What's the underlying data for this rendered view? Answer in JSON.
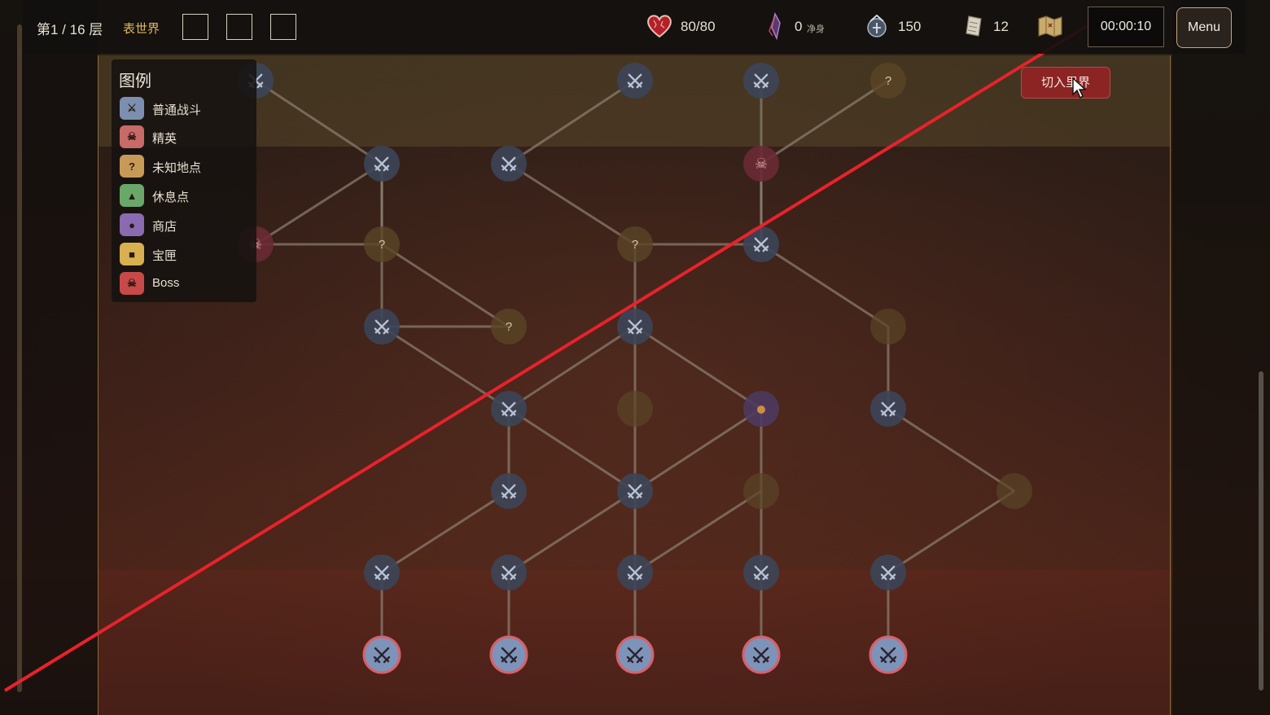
{
  "hud": {
    "floor": "第1 / 16 层",
    "world": "表世界",
    "hp": "80/80",
    "purify_value": "0",
    "purify_label": "净身",
    "soul": "150",
    "cards": "12",
    "timer": "00:00:10",
    "menu_label": "Menu",
    "icons": [
      "heart-icon",
      "crystal-icon",
      "soul-orb-icon",
      "scroll-icon",
      "map-icon"
    ]
  },
  "legend": {
    "title": "图例",
    "items": [
      {
        "label": "普通战斗",
        "icon": "crossed-swords-icon",
        "color": "#7d8fb0"
      },
      {
        "label": "精英",
        "icon": "elite-skull-icon",
        "color": "#c86a68"
      },
      {
        "label": "未知地点",
        "icon": "question-icon",
        "color": "#c89a58"
      },
      {
        "label": "休息点",
        "icon": "campfire-icon",
        "color": "#6aa86a"
      },
      {
        "label": "商店",
        "icon": "shop-bag-icon",
        "color": "#8a6ab0"
      },
      {
        "label": "宝匣",
        "icon": "treasure-chest-icon",
        "color": "#d8b050"
      },
      {
        "label": "Boss",
        "icon": "boss-skull-icon",
        "color": "#c84a48"
      }
    ]
  },
  "switch_button": "切入里界",
  "map": {
    "colors": {
      "combat": "#3c4558",
      "elite": "#6a2a34",
      "unknown": "#5a4526",
      "shop": "#4e3a60",
      "edge": "#8d8273",
      "start_fill": "#7e93b8",
      "start_ring": "#d8606a",
      "slash_line": "#e8222c"
    },
    "nodes": [
      {
        "id": "a",
        "type": "combat",
        "row": 1,
        "col": 0
      },
      {
        "id": "b",
        "type": "combat",
        "row": 1,
        "col": 1
      },
      {
        "id": "c",
        "type": "combat",
        "row": 1,
        "col": 2
      },
      {
        "id": "d",
        "type": "combat",
        "row": 1,
        "col": 3
      },
      {
        "id": "e",
        "type": "combat",
        "row": 1,
        "col": 4
      },
      {
        "id": "f",
        "type": "combat",
        "row": 2,
        "col": 1
      },
      {
        "id": "g",
        "type": "combat",
        "row": 2,
        "col": 2
      },
      {
        "id": "h",
        "type": "empty",
        "row": 2,
        "col": 3
      },
      {
        "id": "i",
        "type": "empty",
        "row": 2,
        "col": 5
      },
      {
        "id": "j",
        "type": "combat",
        "row": 3,
        "col": 1
      },
      {
        "id": "k",
        "type": "empty",
        "row": 3,
        "col": 2
      },
      {
        "id": "l",
        "type": "shop",
        "row": 3,
        "col": 3
      },
      {
        "id": "m",
        "type": "combat",
        "row": 3,
        "col": 4
      },
      {
        "id": "n",
        "type": "combat",
        "row": 4,
        "col": 0
      },
      {
        "id": "o",
        "type": "unknown",
        "row": 4,
        "col": 1,
        "label": "?"
      },
      {
        "id": "p",
        "type": "combat",
        "row": 4,
        "col": 2
      },
      {
        "id": "q",
        "type": "empty",
        "row": 4,
        "col": 4
      },
      {
        "id": "r",
        "type": "unknown",
        "row": 5,
        "col": 0,
        "label": "?"
      },
      {
        "id": "s",
        "type": "unknown",
        "row": 5,
        "col": 2,
        "label": "?"
      },
      {
        "id": "t",
        "type": "combat",
        "row": 5,
        "col": 3
      },
      {
        "id": "u",
        "type": "combat",
        "row": 6,
        "col": 0
      },
      {
        "id": "v",
        "type": "combat",
        "row": 6,
        "col": 1
      },
      {
        "id": "w",
        "type": "elite",
        "row": 6,
        "col": 3
      },
      {
        "id": "x",
        "type": "combat",
        "row": 7,
        "col": 2
      },
      {
        "id": "y",
        "type": "combat",
        "row": 7,
        "col": 3
      },
      {
        "id": "z",
        "type": "unknown",
        "row": 7,
        "col": 4,
        "label": "?"
      },
      {
        "id": "aa",
        "type": "combat",
        "row": 7,
        "col": -1
      },
      {
        "id": "ab",
        "type": "elite",
        "row": 5,
        "col": -1
      }
    ],
    "start_nodes": [
      {
        "id": "s0",
        "col": 0
      },
      {
        "id": "s1",
        "col": 1
      },
      {
        "id": "s2",
        "col": 2
      },
      {
        "id": "s3",
        "col": 3
      },
      {
        "id": "s4",
        "col": 4
      }
    ],
    "edges": [
      [
        "s0",
        "a"
      ],
      [
        "s1",
        "b"
      ],
      [
        "s2",
        "c"
      ],
      [
        "s3",
        "d"
      ],
      [
        "s4",
        "e"
      ],
      [
        "a",
        "f"
      ],
      [
        "b",
        "g"
      ],
      [
        "c",
        "g"
      ],
      [
        "c",
        "h"
      ],
      [
        "d",
        "h"
      ],
      [
        "e",
        "i"
      ],
      [
        "f",
        "j"
      ],
      [
        "g",
        "j"
      ],
      [
        "g",
        "k"
      ],
      [
        "g",
        "l"
      ],
      [
        "h",
        "l"
      ],
      [
        "i",
        "m"
      ],
      [
        "j",
        "n"
      ],
      [
        "j",
        "p"
      ],
      [
        "k",
        "p"
      ],
      [
        "l",
        "p"
      ],
      [
        "m",
        "q"
      ],
      [
        "n",
        "o"
      ],
      [
        "o",
        "r"
      ],
      [
        "p",
        "s"
      ],
      [
        "q",
        "t"
      ],
      [
        "r",
        "u"
      ],
      [
        "r",
        "ab"
      ],
      [
        "s",
        "v"
      ],
      [
        "s",
        "t"
      ],
      [
        "t",
        "w"
      ],
      [
        "u",
        "aa"
      ],
      [
        "u",
        "n"
      ],
      [
        "v",
        "x"
      ],
      [
        "w",
        "y"
      ],
      [
        "w",
        "z"
      ],
      [
        "w",
        "t"
      ],
      [
        "ab",
        "u"
      ]
    ]
  }
}
